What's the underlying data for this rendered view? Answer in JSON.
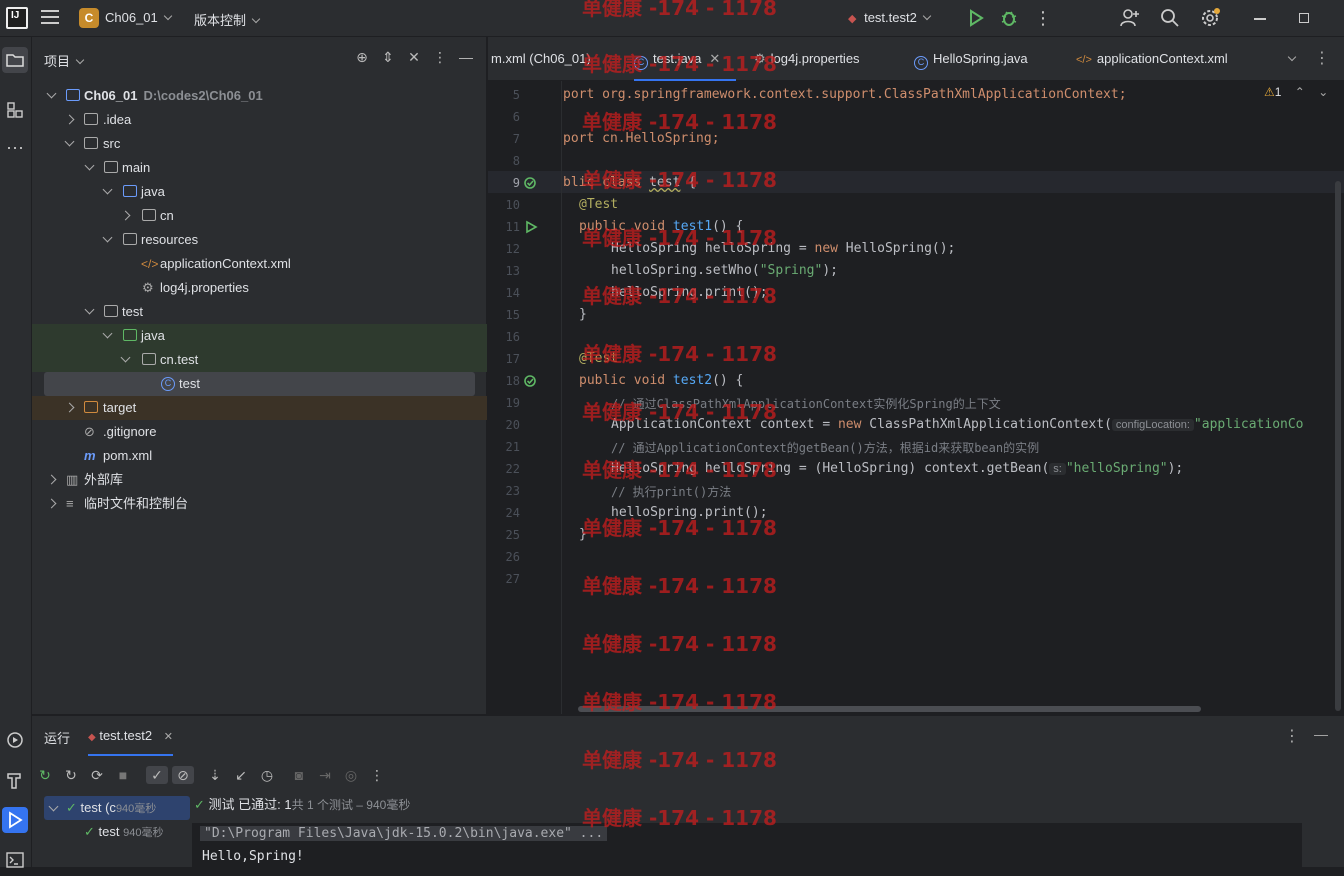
{
  "titlebar": {
    "project_badge": "C",
    "project_name": "Ch06_01",
    "vcs_label": "版本控制",
    "run_config": "test.test2"
  },
  "project_panel": {
    "title": "项目",
    "tree": [
      {
        "label": "Ch06_01",
        "path": "D:\\codes2\\Ch06_01"
      },
      {
        "label": ".idea"
      },
      {
        "label": "src"
      },
      {
        "label": "main"
      },
      {
        "label": "java"
      },
      {
        "label": "cn"
      },
      {
        "label": "resources"
      },
      {
        "label": "applicationContext.xml"
      },
      {
        "label": "log4j.properties"
      },
      {
        "label": "test"
      },
      {
        "label": "java"
      },
      {
        "label": "cn.test"
      },
      {
        "label": "test"
      },
      {
        "label": "target"
      },
      {
        "label": ".gitignore"
      },
      {
        "label": "pom.xml"
      },
      {
        "label": "外部库"
      },
      {
        "label": "临时文件和控制台"
      }
    ]
  },
  "editor_tabs": [
    {
      "label": "m.xml (Ch06_01)"
    },
    {
      "label": "test.java"
    },
    {
      "label": "log4j.properties"
    },
    {
      "label": "HelloSpring.java"
    },
    {
      "label": "applicationContext.xml"
    }
  ],
  "editor": {
    "warning_count": "1",
    "line_numbers": [
      "5",
      "6",
      "7",
      "8",
      "9",
      "10",
      "11",
      "12",
      "13",
      "14",
      "15",
      "16",
      "17",
      "18",
      "19",
      "20",
      "21",
      "22",
      "23",
      "24",
      "25",
      "26",
      "27"
    ],
    "lines": {
      "l5": "port org.springframework.context.support.ClassPathXmlApplicationContext;",
      "l6": "port cn.HelloSpring;",
      "l9a": "blic class ",
      "l9b": "test",
      "l9c": " {",
      "l10": "@Test",
      "l11a": "public void ",
      "l11b": "test1",
      "l11c": "() {",
      "l12a": "HelloSpring helloSpring = ",
      "l12b": "new",
      "l12c": " HelloSpring();",
      "l13a": "helloSpring.setWho(",
      "l13b": "\"Spring\"",
      "l13c": ");",
      "l14": "helloSpring.print();",
      "l15": "}",
      "l17": "@Test",
      "l18a": "public void ",
      "l18b": "test2",
      "l18c": "() {",
      "l19": "// 通过ClassPathXmlApplicationContext实例化Spring的上下文",
      "l20a": "ApplicationContext context = ",
      "l20b": "new",
      "l20c": " ClassPathXmlApplicationContext(",
      "l20hint": "configLocation:",
      "l20d": "\"applicationCo",
      "l21": "// 通过ApplicationContext的getBean()方法，根据id来获取bean的实例",
      "l22a": "HelloSpring helloSpring = (HelloSpring) context.getBean(",
      "l22hint": "s:",
      "l22b": "\"helloSpring\"",
      "l22c": ");",
      "l23": "// 执行print()方法",
      "l24": "helloSpring.print();",
      "l25": "}"
    }
  },
  "run_panel": {
    "title": "运行",
    "tab": "test.test2",
    "tree": [
      {
        "label": "test (c",
        "time": "940毫秒"
      },
      {
        "label": "test",
        "time": "940毫秒"
      }
    ],
    "status_prefix": "测试 已通过: ",
    "status_count": "1",
    "status_suffix": "共 1 个测试 – 940毫秒",
    "console": [
      "\"D:\\Program Files\\Java\\jdk-15.0.2\\bin\\java.exe\" ...",
      "Hello,Spring!"
    ]
  },
  "watermark": "单健康 -174 - 1178"
}
